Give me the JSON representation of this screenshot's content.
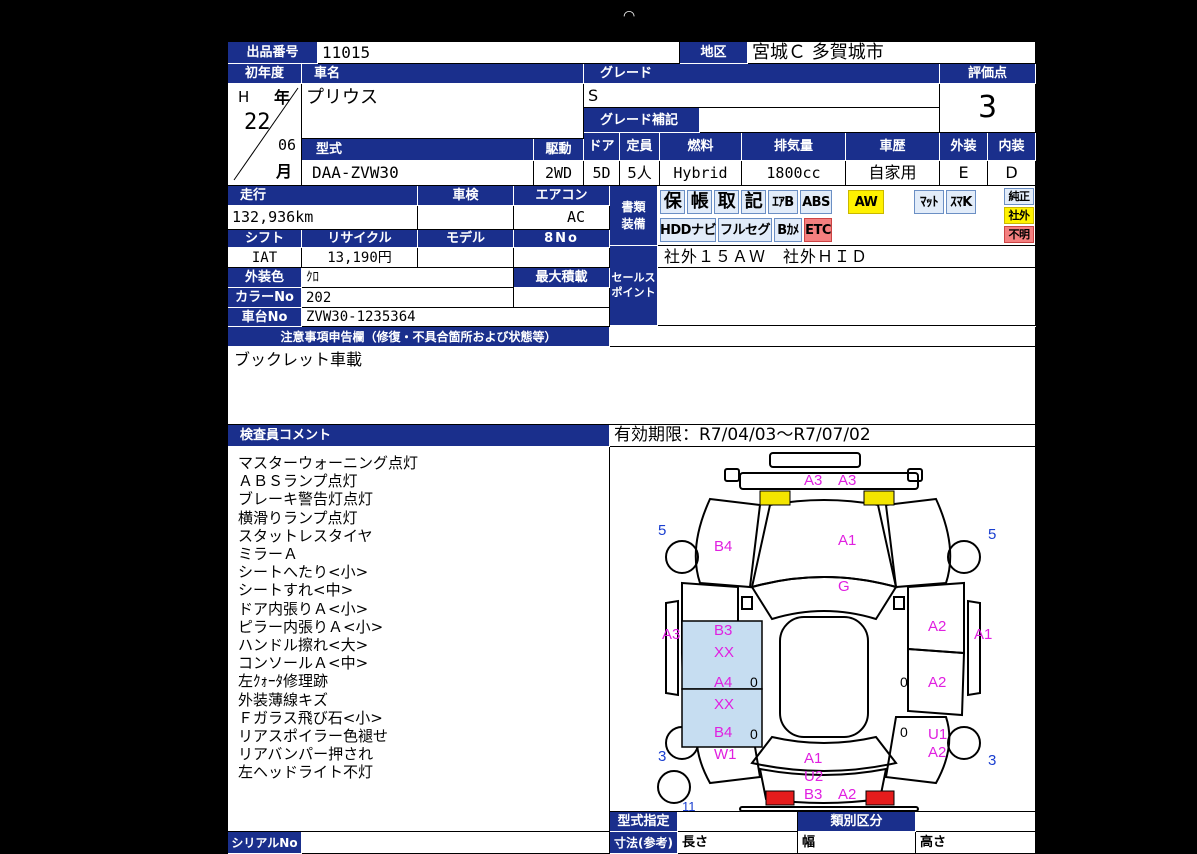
{
  "top_icon": "wifi-icon",
  "colors": {
    "header": "#1a2f8c",
    "damage_label": "#e020e0",
    "panel_number": "#1a3fd0",
    "highlight": "#c6ddf1"
  },
  "labels": {
    "lot_no": "出品番号",
    "region": "地区",
    "first_reg": "初年度",
    "car_name": "車名",
    "grade": "グレード",
    "score": "評価点",
    "grade_note": "グレード補記",
    "model": "型式",
    "drive": "駆動",
    "doors": "ドア",
    "capacity": "定員",
    "fuel": "燃料",
    "displacement": "排気量",
    "history": "車歴",
    "exterior": "外装",
    "interior": "内装",
    "mileage": "走行",
    "inspection": "車検",
    "aircon": "エアコン",
    "doc_equip_1": "書類",
    "doc_equip_2": "装備",
    "shift": "シフト",
    "recycle": "リサイクル",
    "model_year": "モデル",
    "8no": "8No",
    "ext_color": "外装色",
    "max_load": "最大積載",
    "color_no": "カラーNo",
    "sales_point_1": "セールス",
    "sales_point_2": "ポイント",
    "chassis_no": "車台No",
    "notes": "注意事項申告欄（修復・不具合箇所および状態等）",
    "inspector_comment": "検査員コメント",
    "serial_no": "シリアルNo",
    "model_designation": "型式指定",
    "class_category": "類別区分",
    "dimensions": "寸法(参考)",
    "length": "長さ",
    "width": "幅",
    "height": "高さ",
    "heisei_h": "H",
    "year": "年",
    "month": "月"
  },
  "values": {
    "lot_no": "11015",
    "region": "宮城Ｃ 多賀城市",
    "year": "22",
    "month": "06",
    "car_name": "プリウス",
    "grade": "S",
    "score": "3",
    "model": "DAA-ZVW30",
    "drive": "2WD",
    "doors": "5D",
    "capacity": "5人",
    "fuel": "Hybrid",
    "displacement": "1800cc",
    "history": "自家用",
    "exterior": "E",
    "interior": "D",
    "mileage": "132,936km",
    "aircon": "AC",
    "shift": "IAT",
    "recycle": "13,190円",
    "ext_color": "ｸﾛ",
    "color_no": "202",
    "chassis_no": "ZVW30-1235364",
    "sales_point": "社外１５ＡＷ　社外ＨＩＤ",
    "notes": "ブックレット車載",
    "validity": "有効期限：R7/04/03～R7/07/02"
  },
  "equipment": {
    "ho": "保",
    "cho": "帳",
    "tori": "取",
    "ki": "記",
    "airbag": "ｴｱB",
    "abs": "ABS",
    "aw": "AW",
    "mat": "ﾏｯﾄ",
    "smart_key": "ｽﾏK",
    "genuine": "純正",
    "aftermarket": "社外",
    "unknown": "不明",
    "hdd_navi": "HDDナビ",
    "full_seg": "フルセグ",
    "back_cam": "Bｶﾒ",
    "etc": "ETC"
  },
  "comments": [
    "マスターウォーニング点灯",
    "ＡＢＳランプ点灯",
    "ブレーキ警告灯点灯",
    "横滑りランプ点灯",
    "スタットレスタイヤ",
    "ミラーＡ",
    "シートへたり<小>",
    "シートすれ<中>",
    "ドア内張りＡ<小>",
    "ピラー内張りＡ<小>",
    "ハンドル擦れ<大>",
    "コンソールＡ<中>",
    "左ｸｫｰﾀ修理跡",
    "外装薄線キズ",
    "Ｆガラス飛び石<小>",
    "リアスポイラー色褪せ",
    "リアバンパー押され",
    "左ヘッドライト不灯"
  ],
  "diagram": {
    "damages": {
      "front_a3_left": "A3",
      "front_a3_right": "A3",
      "b4_front": "B4",
      "a1_hood": "A1",
      "g_glass": "G",
      "a3_left_fender": "A3",
      "b3": "B3",
      "xx_1": "XX",
      "a2_right_front_door": "A2",
      "a1_right_fender": "A1",
      "a4": "A4",
      "xx_2": "XX",
      "a2_right_rear_door": "A2",
      "b4_rear": "B4",
      "w1": "W1",
      "u1": "U1",
      "a2_right_quarter": "A2",
      "a1_rear": "A1",
      "u2": "U2",
      "b3_rear": "B3",
      "a2_rear": "A2"
    },
    "panels": {
      "front_left": "5",
      "front_right": "5",
      "rear_left": "3",
      "rear_right": "3",
      "spare": "11"
    },
    "zeros": {
      "z1": "0",
      "z2": "0",
      "z3": "0",
      "z4": "0"
    }
  }
}
